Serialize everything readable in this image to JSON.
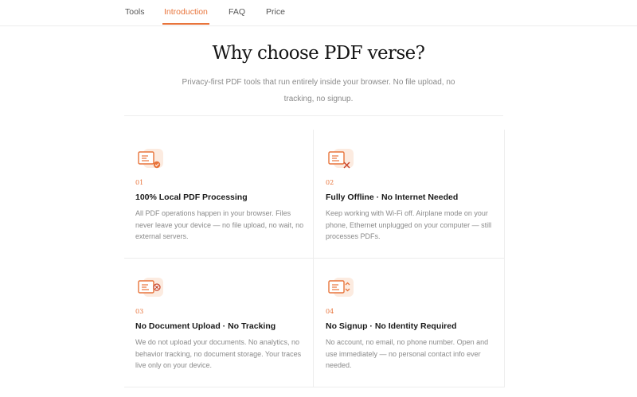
{
  "nav": {
    "items": [
      "Tools",
      "Introduction",
      "FAQ",
      "Price"
    ],
    "active": "Introduction"
  },
  "hero": {
    "title": "Why choose PDF verse?",
    "subtitle": "Privacy-first PDF tools that run entirely inside your browser. No file upload, no tracking, no signup."
  },
  "features": [
    {
      "number": "01",
      "icon": "document-check-icon",
      "title": "100% Local PDF Processing",
      "description": "All PDF operations happen in your browser. Files never leave your device — no file upload, no wait, no external servers."
    },
    {
      "number": "02",
      "icon": "document-offline-icon",
      "title": "Fully Offline · No Internet Needed",
      "description": "Keep working with Wi-Fi off. Airplane mode on your phone, Ethernet unplugged on your computer — still processes PDFs."
    },
    {
      "number": "03",
      "icon": "document-no-upload-icon",
      "title": "No Document Upload · No Tracking",
      "description": "We do not upload your documents. No analytics, no behavior tracking, no document storage. Your traces live only on your device."
    },
    {
      "number": "04",
      "icon": "document-sort-icon",
      "title": "No Signup · No Identity Required",
      "description": "No account, no email, no phone number. Open and use immediately — no personal contact info ever needed."
    }
  ],
  "colors": {
    "accent": "#e8743b",
    "accent_dark": "#c9472c",
    "icon_bg": "#fcebe0"
  }
}
